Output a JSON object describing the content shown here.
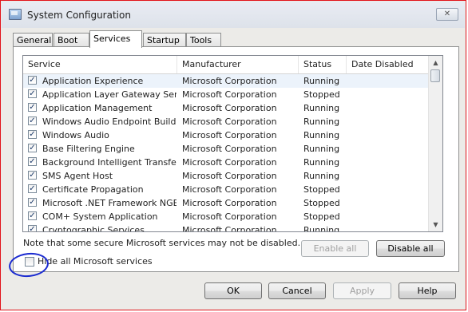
{
  "window": {
    "title": "System Configuration",
    "close_label": "✕"
  },
  "tabs": [
    {
      "label": "General"
    },
    {
      "label": "Boot"
    },
    {
      "label": "Services"
    },
    {
      "label": "Startup"
    },
    {
      "label": "Tools"
    }
  ],
  "active_tab": "Services",
  "table": {
    "headers": {
      "service": "Service",
      "manufacturer": "Manufacturer",
      "status": "Status",
      "date_disabled": "Date Disabled"
    },
    "rows": [
      {
        "checked": true,
        "service": "Application Experience",
        "manufacturer": "Microsoft Corporation",
        "status": "Running",
        "date_disabled": ""
      },
      {
        "checked": true,
        "service": "Application Layer Gateway Service",
        "manufacturer": "Microsoft Corporation",
        "status": "Stopped",
        "date_disabled": ""
      },
      {
        "checked": true,
        "service": "Application Management",
        "manufacturer": "Microsoft Corporation",
        "status": "Running",
        "date_disabled": ""
      },
      {
        "checked": true,
        "service": "Windows Audio Endpoint Builder",
        "manufacturer": "Microsoft Corporation",
        "status": "Running",
        "date_disabled": ""
      },
      {
        "checked": true,
        "service": "Windows Audio",
        "manufacturer": "Microsoft Corporation",
        "status": "Running",
        "date_disabled": ""
      },
      {
        "checked": true,
        "service": "Base Filtering Engine",
        "manufacturer": "Microsoft Corporation",
        "status": "Running",
        "date_disabled": ""
      },
      {
        "checked": true,
        "service": "Background Intelligent Transfer ...",
        "manufacturer": "Microsoft Corporation",
        "status": "Running",
        "date_disabled": ""
      },
      {
        "checked": true,
        "service": "SMS Agent Host",
        "manufacturer": "Microsoft Corporation",
        "status": "Running",
        "date_disabled": ""
      },
      {
        "checked": true,
        "service": "Certificate Propagation",
        "manufacturer": "Microsoft Corporation",
        "status": "Stopped",
        "date_disabled": ""
      },
      {
        "checked": true,
        "service": "Microsoft .NET Framework NGEN...",
        "manufacturer": "Microsoft Corporation",
        "status": "Stopped",
        "date_disabled": ""
      },
      {
        "checked": true,
        "service": "COM+ System Application",
        "manufacturer": "Microsoft Corporation",
        "status": "Stopped",
        "date_disabled": ""
      },
      {
        "checked": true,
        "service": "Cryptographic Services",
        "manufacturer": "Microsoft Corporation",
        "status": "Running",
        "date_disabled": ""
      }
    ]
  },
  "note": "Note that some secure Microsoft services may not be disabled.",
  "buttons": {
    "enable_all": "Enable all",
    "disable_all": "Disable all",
    "ok": "OK",
    "cancel": "Cancel",
    "apply": "Apply",
    "help": "Help"
  },
  "hide_ms": {
    "label": "Hide all Microsoft services",
    "checked": false
  },
  "colors": {
    "annotation": "#1b2bd0",
    "window_border": "#e2131a",
    "row_selected": "#ecf3fb"
  }
}
